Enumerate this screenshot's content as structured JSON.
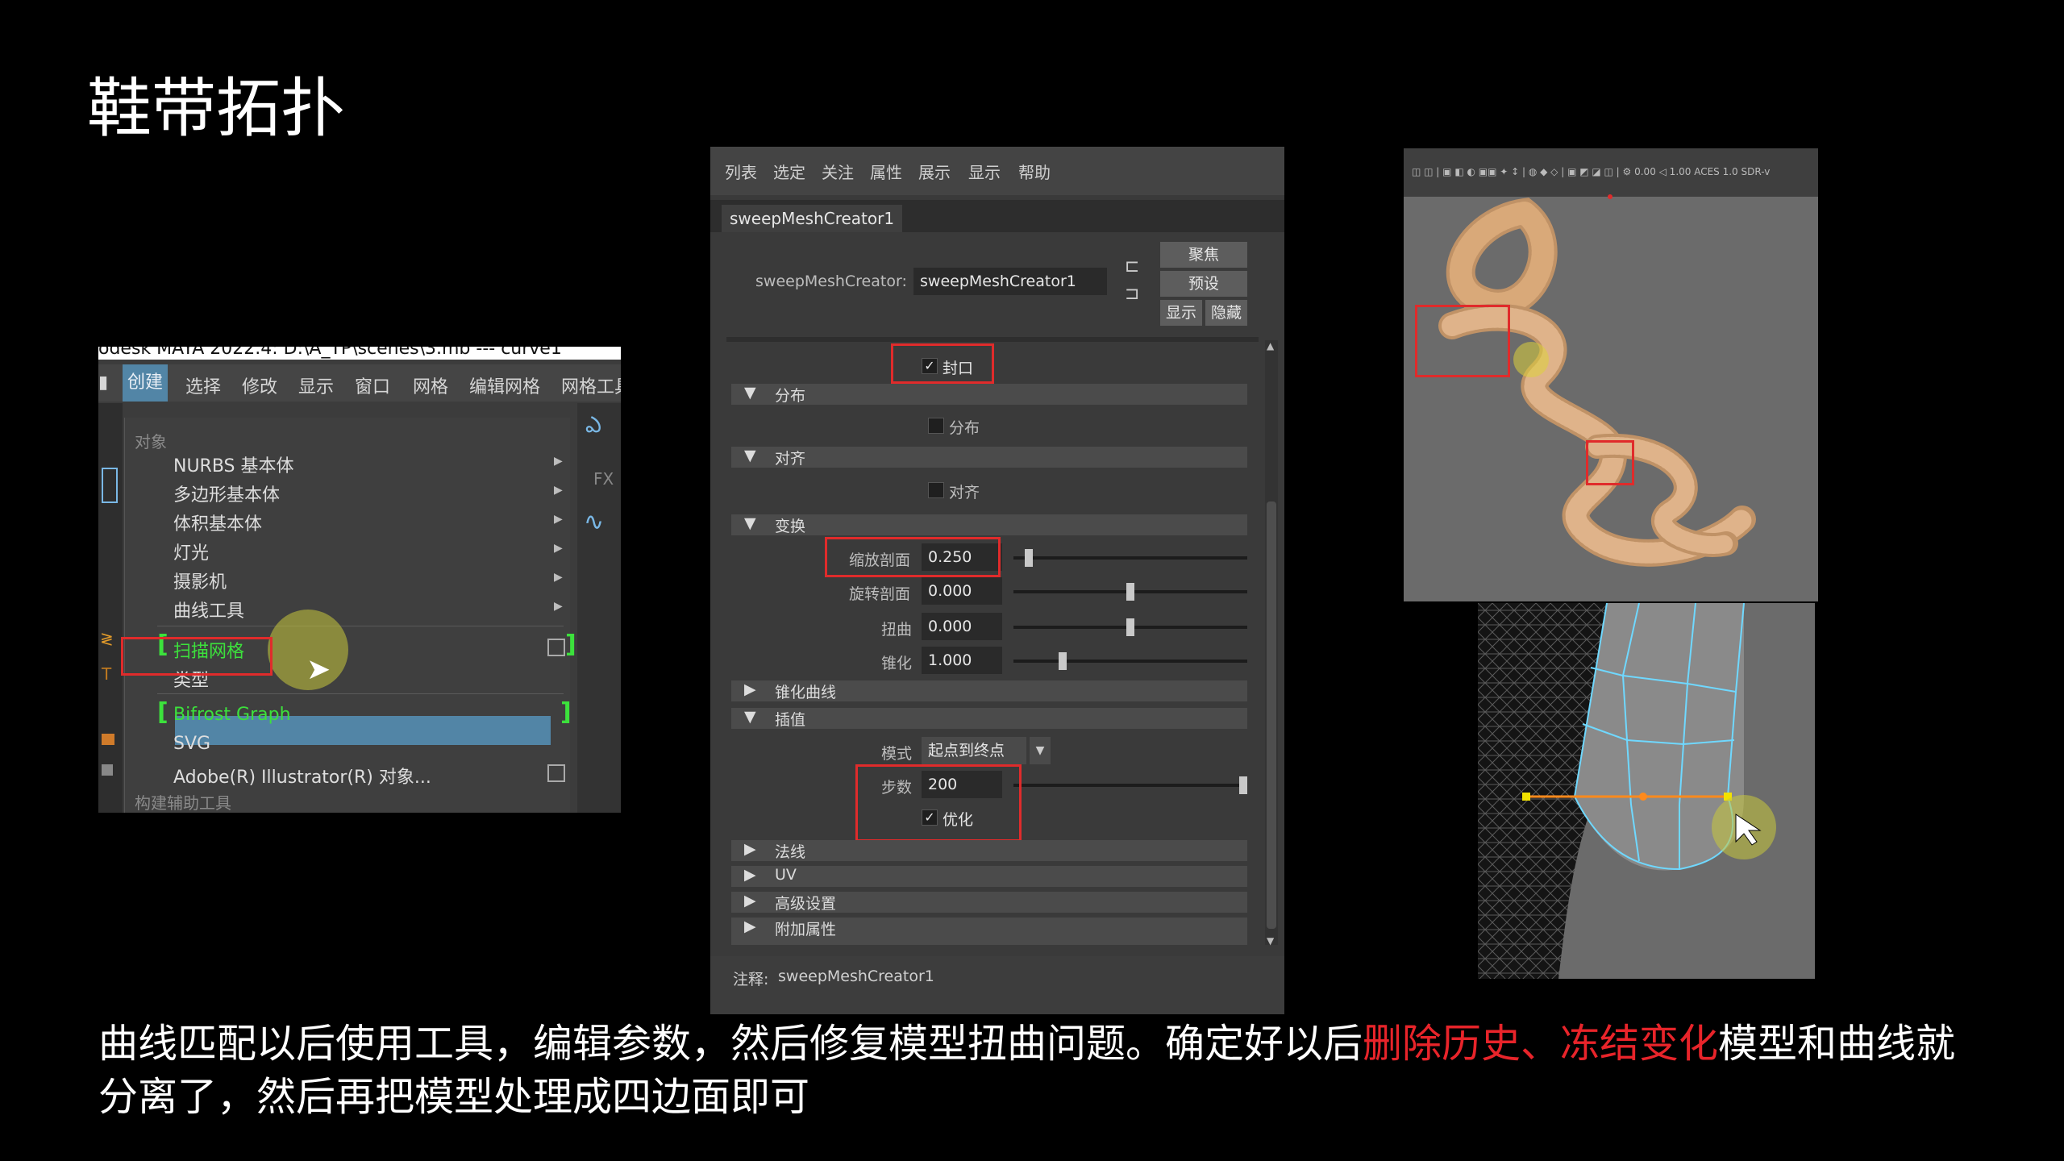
{
  "slide": {
    "title": "鞋带拓扑",
    "caption_part1": "曲线匹配以后使用工具，编辑参数，然后修复模型扭曲问题。确定好以后",
    "caption_highlight": "删除历史、冻结变化",
    "caption_part2": "模型和曲线就分离了，然后再把模型处理成四边面即可"
  },
  "maya_menu": {
    "titlebar": "odesk MAYA 2022.4: D:\\A_TP\\scenes\\3.mb  ---  curve1",
    "menubar": [
      "创建",
      "选择",
      "修改",
      "显示",
      "窗口",
      "网格",
      "编辑网格",
      "网格工具"
    ],
    "section_object": "对象",
    "items": [
      "NURBS 基本体",
      "多边形基本体",
      "体积基本体",
      "灯光",
      "摄影机",
      "曲线工具"
    ],
    "highlighted_item": "扫描网格",
    "type_item": "类型",
    "bifrost_item": "Bifrost Graph",
    "svg_item": "SVG",
    "illustrator_item": "Adobe(R) Illustrator(R) 对象...",
    "section_build": "构建辅助工具",
    "right_tool_label": "FX"
  },
  "attr_editor": {
    "menubar": [
      "列表",
      "选定",
      "关注",
      "属性",
      "展示",
      "显示",
      "帮助"
    ],
    "tab": "sweepMeshCreator1",
    "node_label": "sweepMeshCreator:",
    "node_value": "sweepMeshCreator1",
    "buttons": {
      "focus": "聚焦",
      "preset": "预设",
      "show": "显示",
      "hide": "隐藏"
    },
    "cap_label": "封口",
    "cap_checked": true,
    "sections": {
      "distribution": "分布",
      "alignment": "对齐",
      "transform": "变换",
      "taper_curve": "锥化曲线",
      "interpolation": "插值",
      "normals": "法线",
      "uv": "UV",
      "advanced": "高级设置",
      "extra": "附加属性"
    },
    "distribution_label": "分布",
    "alignment_label": "对齐",
    "transform_fields": [
      {
        "label": "缩放剖面",
        "value": "0.250",
        "slider": 0.05
      },
      {
        "label": "旋转剖面",
        "value": "0.000",
        "slider": 0.5
      },
      {
        "label": "扭曲",
        "value": "0.000",
        "slider": 0.5
      },
      {
        "label": "锥化",
        "value": "1.000",
        "slider": 0.2
      }
    ],
    "mode_label": "模式",
    "mode_value": "起点到终点",
    "steps_label": "步数",
    "steps_value": "200",
    "steps_slider": 1.0,
    "optimize_label": "优化",
    "optimize_checked": true,
    "notes_label": "注释:",
    "notes_value": "sweepMeshCreator1"
  },
  "viewport": {
    "shelf_text": "◫ ◫ | ▣ ◧ ◐ ▣▣ ✦ ↕ | ◍ ◆ ◇ | ▣ ◩ ◪ ◫ | ⚙ 0.00 ◁ 1.00  ACES 1.0 SDR-v"
  },
  "colors": {
    "highlight_red": "#e8242a",
    "maya_selection": "#5285a6",
    "rope": "#d9a979",
    "wire_edge": "#6fd8ff",
    "vertex_yellow": "#f2e200"
  }
}
